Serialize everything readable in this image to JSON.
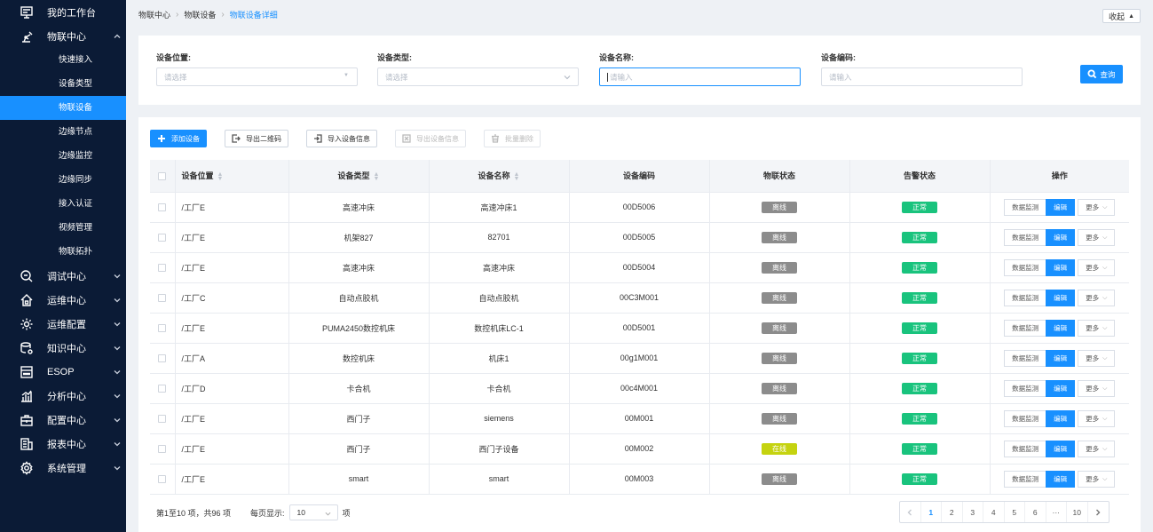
{
  "sidebar": {
    "items": [
      {
        "label": "我的工作台",
        "icon": "monitor-icon",
        "expandable": false
      },
      {
        "label": "物联中心",
        "icon": "robot-arm-icon",
        "expandable": true,
        "expanded": true,
        "children": [
          "快速接入",
          "设备类型",
          "物联设备",
          "边缘节点",
          "边缘监控",
          "边缘同步",
          "接入认证",
          "视频管理",
          "物联拓扑"
        ],
        "active_child": "物联设备"
      },
      {
        "label": "调试中心",
        "icon": "debug-icon",
        "expandable": true
      },
      {
        "label": "运维中心",
        "icon": "house-icon",
        "expandable": true
      },
      {
        "label": "运维配置",
        "icon": "cog-config-icon",
        "expandable": true
      },
      {
        "label": "知识中心",
        "icon": "database-icon",
        "expandable": true
      },
      {
        "label": "ESOP",
        "icon": "esop-icon",
        "expandable": true
      },
      {
        "label": "分析中心",
        "icon": "bar-chart-icon",
        "expandable": true
      },
      {
        "label": "配置中心",
        "icon": "toolbox-icon",
        "expandable": true
      },
      {
        "label": "报表中心",
        "icon": "report-icon",
        "expandable": true
      },
      {
        "label": "系统管理",
        "icon": "gear-icon",
        "expandable": true
      }
    ]
  },
  "breadcrumb": {
    "items": [
      "物联中心",
      "物联设备"
    ],
    "current": "物联设备详细"
  },
  "collapse_label": "收起",
  "filters": {
    "location": {
      "label": "设备位置:",
      "placeholder": "请选择"
    },
    "type": {
      "label": "设备类型:",
      "placeholder": "请选择"
    },
    "name": {
      "label": "设备名称:",
      "placeholder": "请输入"
    },
    "code": {
      "label": "设备编码:",
      "placeholder": "请输入"
    },
    "query_label": "查询"
  },
  "toolbar": {
    "add": "添加设备",
    "export_qr": "导出二维码",
    "import_info": "导入设备信息",
    "export_info": "导出设备信息",
    "batch_delete": "批量删除"
  },
  "table": {
    "columns": [
      "设备位置",
      "设备类型",
      "设备名称",
      "设备编码",
      "物联状态",
      "告警状态",
      "操作"
    ],
    "rows": [
      {
        "location": "/工厂E",
        "type": "高速冲床",
        "name": "高速冲床1",
        "code": "00D5006",
        "iot_status": "离线",
        "alarm": "正常"
      },
      {
        "location": "/工厂E",
        "type": "机架827",
        "name": "82701",
        "code": "00D5005",
        "iot_status": "离线",
        "alarm": "正常"
      },
      {
        "location": "/工厂E",
        "type": "高速冲床",
        "name": "高速冲床",
        "code": "00D5004",
        "iot_status": "离线",
        "alarm": "正常"
      },
      {
        "location": "/工厂C",
        "type": "自动点胶机",
        "name": "自动点胶机",
        "code": "00C3M001",
        "iot_status": "离线",
        "alarm": "正常"
      },
      {
        "location": "/工厂E",
        "type": "PUMA2450数控机床",
        "name": "数控机床LC-1",
        "code": "00D5001",
        "iot_status": "离线",
        "alarm": "正常"
      },
      {
        "location": "/工厂A",
        "type": "数控机床",
        "name": "机床1",
        "code": "00g1M001",
        "iot_status": "离线",
        "alarm": "正常"
      },
      {
        "location": "/工厂D",
        "type": "卡合机",
        "name": "卡合机",
        "code": "00c4M001",
        "iot_status": "离线",
        "alarm": "正常"
      },
      {
        "location": "/工厂E",
        "type": "西门子",
        "name": "siemens",
        "code": "00M001",
        "iot_status": "离线",
        "alarm": "正常"
      },
      {
        "location": "/工厂E",
        "type": "西门子",
        "name": "西门子设备",
        "code": "00M002",
        "iot_status": "在线",
        "alarm": "正常"
      },
      {
        "location": "/工厂E",
        "type": "smart",
        "name": "smart",
        "code": "00M003",
        "iot_status": "离线",
        "alarm": "正常"
      }
    ],
    "row_actions": {
      "monitor": "数据监测",
      "edit": "编辑",
      "more": "更多"
    }
  },
  "footer": {
    "summary": "第1至10 项，共96 项",
    "page_size_label": "每页显示:",
    "page_size": "10",
    "page_size_unit": "项"
  },
  "pagination": {
    "pages": [
      "1",
      "2",
      "3",
      "4",
      "5",
      "6",
      "···",
      "10"
    ],
    "current": "1"
  },
  "colors": {
    "sidebar_bg": "#0b1b36",
    "accent": "#1890ff",
    "offline": "#8c8c8c",
    "online": "#c5d310",
    "normal": "#19c37d"
  }
}
